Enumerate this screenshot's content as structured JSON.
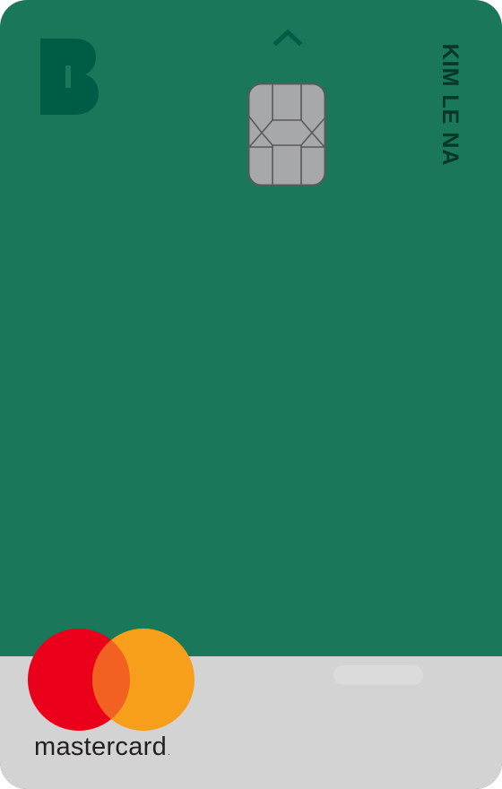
{
  "card": {
    "holder_name": "KIM LE NA",
    "brand_logo_icon": "bank-b-logo-icon",
    "expand_icon": "chevron-up-icon",
    "chip_icon": "emv-chip-icon",
    "network": {
      "name": "mastercard",
      "trademark": ".",
      "logo_icon": "mastercard-circles-icon"
    }
  },
  "colors": {
    "card_green": "#1b775a",
    "logo_dark_green": "#005d45",
    "band_gray": "#d3d3d3",
    "mc_red": "#eb001b",
    "mc_orange": "#f79e1b",
    "mc_overlap": "#ff5f00",
    "chip_gray": "#a7a8aa"
  }
}
